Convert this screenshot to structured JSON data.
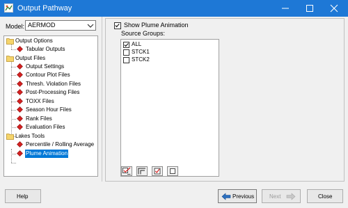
{
  "window": {
    "title": "Output Pathway"
  },
  "model": {
    "label": "Model:",
    "value": "AERMOD"
  },
  "tree": {
    "items": [
      {
        "label": "Output Options"
      },
      {
        "label": "Tabular Outputs"
      },
      {
        "label": "Output Files"
      },
      {
        "label": "Output Settings"
      },
      {
        "label": "Contour Plot Files"
      },
      {
        "label": "Thresh. Violation Files"
      },
      {
        "label": "Post-Processing Files"
      },
      {
        "label": "TOXX Files"
      },
      {
        "label": "Season Hour Files"
      },
      {
        "label": "Rank Files"
      },
      {
        "label": "Evaluation Files"
      },
      {
        "label": "Lakes Tools"
      },
      {
        "label": "Percentile / Rolling Average"
      },
      {
        "label": "Plume Animation"
      }
    ]
  },
  "show_plume": {
    "label": "Show Plume Animation",
    "checked": true
  },
  "source_groups": {
    "label": "Source Groups:",
    "items": [
      {
        "label": "ALL",
        "checked": true
      },
      {
        "label": "STCK1",
        "checked": false
      },
      {
        "label": "STCK2",
        "checked": false
      }
    ]
  },
  "footer": {
    "help": "Help",
    "previous": "Previous",
    "next": "Next",
    "close": "Close"
  }
}
